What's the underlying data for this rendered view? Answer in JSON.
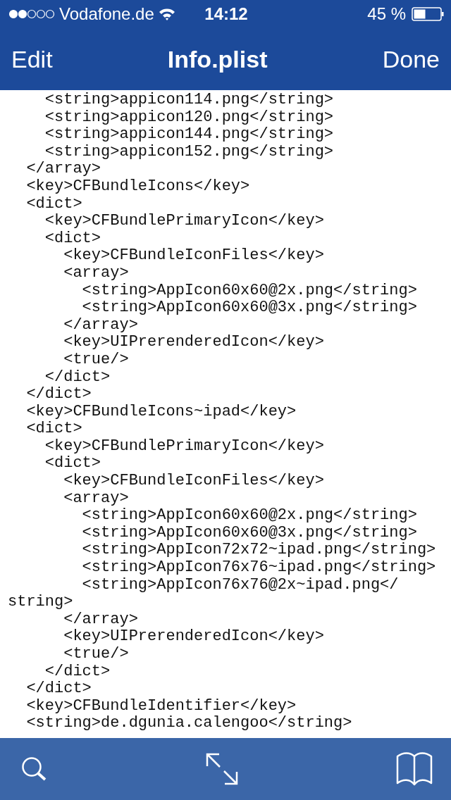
{
  "status_bar": {
    "carrier": "Vodafone.de",
    "time": "14:12",
    "battery": "45 %"
  },
  "nav_bar": {
    "left_button": "Edit",
    "title": "Info.plist",
    "right_button": "Done"
  },
  "code_lines": [
    "    <string>appicon114.png</string>",
    "    <string>appicon120.png</string>",
    "    <string>appicon144.png</string>",
    "    <string>appicon152.png</string>",
    "  </array>",
    "  <key>CFBundleIcons</key>",
    "  <dict>",
    "    <key>CFBundlePrimaryIcon</key>",
    "    <dict>",
    "      <key>CFBundleIconFiles</key>",
    "      <array>",
    "        <string>AppIcon60x60@2x.png</string>",
    "        <string>AppIcon60x60@3x.png</string>",
    "      </array>",
    "      <key>UIPrerenderedIcon</key>",
    "      <true/>",
    "    </dict>",
    "  </dict>",
    "  <key>CFBundleIcons~ipad</key>",
    "  <dict>",
    "    <key>CFBundlePrimaryIcon</key>",
    "    <dict>",
    "      <key>CFBundleIconFiles</key>",
    "      <array>",
    "        <string>AppIcon60x60@2x.png</string>",
    "        <string>AppIcon60x60@3x.png</string>",
    "        <string>AppIcon72x72~ipad.png</string>",
    "        <string>AppIcon76x76~ipad.png</string>",
    "        <string>AppIcon76x76@2x~ipad.png</",
    "string>",
    "      </array>",
    "      <key>UIPrerenderedIcon</key>",
    "      <true/>",
    "    </dict>",
    "  </dict>",
    "  <key>CFBundleIdentifier</key>",
    "  <string>de.dgunia.calengoo</string>"
  ]
}
